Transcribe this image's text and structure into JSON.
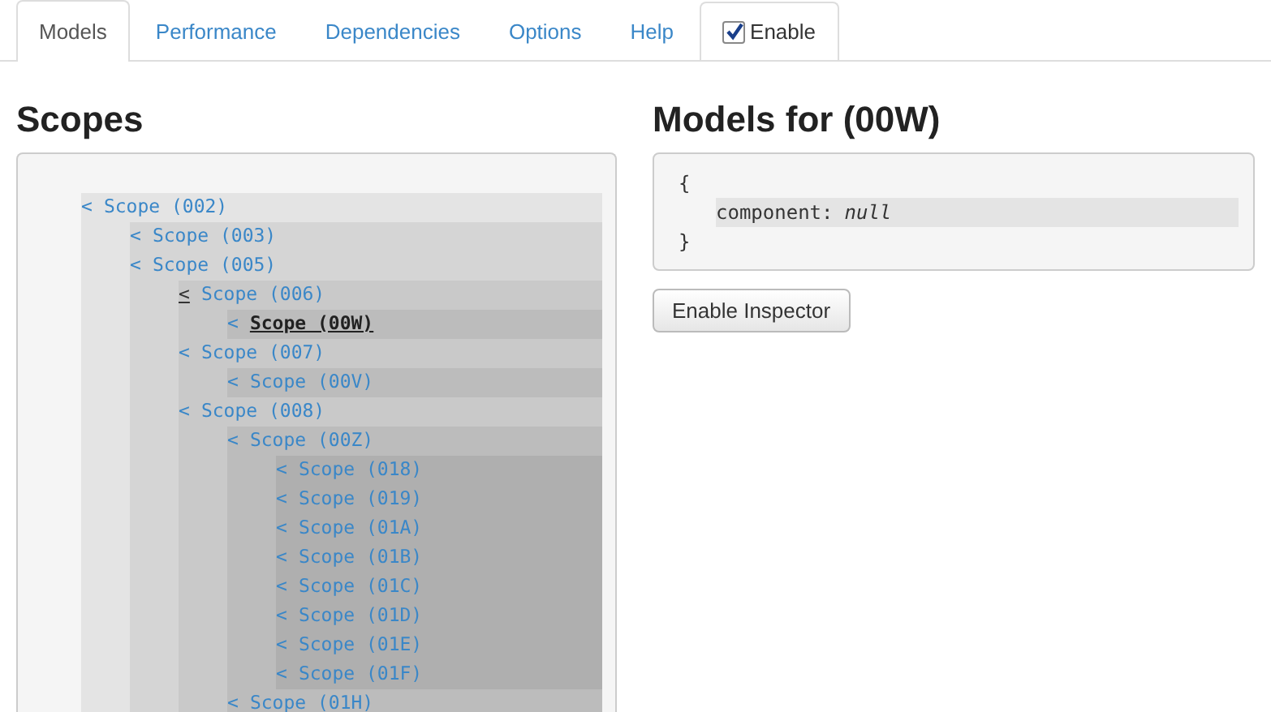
{
  "tabs": [
    {
      "label": "Models",
      "selected": true,
      "kind": "text"
    },
    {
      "label": "Performance",
      "selected": false,
      "kind": "text"
    },
    {
      "label": "Dependencies",
      "selected": false,
      "kind": "text"
    },
    {
      "label": "Options",
      "selected": false,
      "kind": "text"
    },
    {
      "label": "Help",
      "selected": false,
      "kind": "text"
    },
    {
      "label": "Enable",
      "selected": false,
      "kind": "checkbox",
      "checked": true
    }
  ],
  "scopes": {
    "title": "Scopes",
    "tree": [
      {
        "toggle": "<",
        "label": "Scope (002)",
        "selected": false,
        "hovered": false,
        "children": [
          {
            "toggle": "<",
            "label": "Scope (003)",
            "selected": false,
            "hovered": false
          },
          {
            "toggle": "<",
            "label": "Scope (005)",
            "selected": false,
            "hovered": false,
            "children": [
              {
                "toggle": "<",
                "label": "Scope (006)",
                "selected": false,
                "hovered": true,
                "children": [
                  {
                    "toggle": "<",
                    "label": "Scope (00W)",
                    "selected": true,
                    "hovered": false
                  }
                ]
              },
              {
                "toggle": "<",
                "label": "Scope (007)",
                "selected": false,
                "hovered": false,
                "children": [
                  {
                    "toggle": "<",
                    "label": "Scope (00V)",
                    "selected": false,
                    "hovered": false
                  }
                ]
              },
              {
                "toggle": "<",
                "label": "Scope (008)",
                "selected": false,
                "hovered": false,
                "children": [
                  {
                    "toggle": "<",
                    "label": "Scope (00Z)",
                    "selected": false,
                    "hovered": false,
                    "children": [
                      {
                        "toggle": "<",
                        "label": "Scope (018)",
                        "selected": false,
                        "hovered": false
                      },
                      {
                        "toggle": "<",
                        "label": "Scope (019)",
                        "selected": false,
                        "hovered": false
                      },
                      {
                        "toggle": "<",
                        "label": "Scope (01A)",
                        "selected": false,
                        "hovered": false
                      },
                      {
                        "toggle": "<",
                        "label": "Scope (01B)",
                        "selected": false,
                        "hovered": false
                      },
                      {
                        "toggle": "<",
                        "label": "Scope (01C)",
                        "selected": false,
                        "hovered": false
                      },
                      {
                        "toggle": "<",
                        "label": "Scope (01D)",
                        "selected": false,
                        "hovered": false
                      },
                      {
                        "toggle": "<",
                        "label": "Scope (01E)",
                        "selected": false,
                        "hovered": false
                      },
                      {
                        "toggle": "<",
                        "label": "Scope (01F)",
                        "selected": false,
                        "hovered": false
                      }
                    ]
                  },
                  {
                    "toggle": "<",
                    "label": "Scope (01H)",
                    "selected": false,
                    "hovered": false
                  }
                ]
              }
            ]
          }
        ]
      }
    ]
  },
  "models": {
    "title": "Models for (00W)",
    "open_brace": "{",
    "close_brace": "}",
    "lines": [
      {
        "key": "component:",
        "value": "null"
      }
    ],
    "button": "Enable Inspector"
  }
}
